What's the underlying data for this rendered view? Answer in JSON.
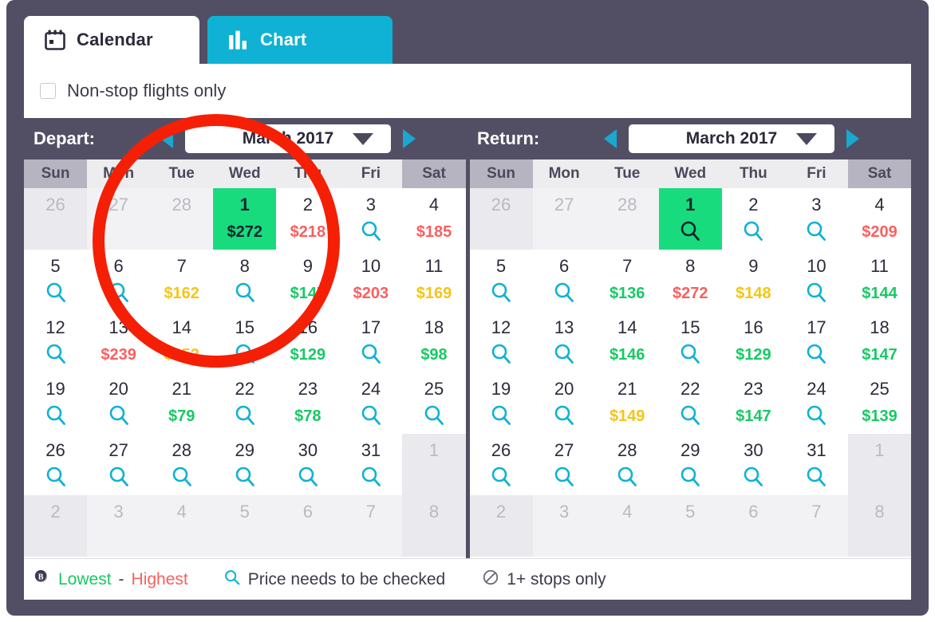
{
  "tabs": [
    {
      "id": "calendar",
      "label": "Calendar",
      "icon": "calendar-icon",
      "active": true
    },
    {
      "id": "chart",
      "label": "Chart",
      "icon": "bar-chart-icon",
      "active": false
    }
  ],
  "filters": {
    "nonstop_label": "Non-stop flights only",
    "nonstop_checked": false
  },
  "colors": {
    "panel": "#524f65",
    "accent_teal": "#0fb2d4",
    "selected_green": "#18db7e",
    "price_low": "#17c964",
    "price_mid": "#f5c518",
    "price_high": "#fb5f5f",
    "annotation_red": "#f51f05"
  },
  "depart": {
    "label": "Depart:",
    "month": "March 2017",
    "prev_icon": "triangle-left-icon",
    "next_icon": "triangle-right-icon",
    "caret_icon": "chevron-down-icon",
    "dow": [
      "Sun",
      "Mon",
      "Tue",
      "Wed",
      "Thu",
      "Fri",
      "Sat"
    ],
    "weeks": [
      [
        {
          "day": "26",
          "out": true
        },
        {
          "day": "27",
          "out": true
        },
        {
          "day": "28",
          "out": true
        },
        {
          "day": "1",
          "price": "$272",
          "tier": "sel",
          "selected": true
        },
        {
          "day": "2",
          "price": "$218",
          "tier": "high"
        },
        {
          "day": "3",
          "mag": true
        },
        {
          "day": "4",
          "price": "$185",
          "tier": "high"
        }
      ],
      [
        {
          "day": "5",
          "mag": true
        },
        {
          "day": "6",
          "mag": true
        },
        {
          "day": "7",
          "price": "$162",
          "tier": "mid"
        },
        {
          "day": "8",
          "mag": true
        },
        {
          "day": "9",
          "price": "$147",
          "tier": "low"
        },
        {
          "day": "10",
          "price": "$203",
          "tier": "high"
        },
        {
          "day": "11",
          "price": "$169",
          "tier": "mid"
        }
      ],
      [
        {
          "day": "12",
          "mag": true
        },
        {
          "day": "13",
          "price": "$239",
          "tier": "high"
        },
        {
          "day": "14",
          "price": "$152",
          "tier": "mid"
        },
        {
          "day": "15",
          "mag": true
        },
        {
          "day": "16",
          "price": "$129",
          "tier": "low"
        },
        {
          "day": "17",
          "mag": true
        },
        {
          "day": "18",
          "price": "$98",
          "tier": "low"
        }
      ],
      [
        {
          "day": "19",
          "mag": true
        },
        {
          "day": "20",
          "mag": true
        },
        {
          "day": "21",
          "price": "$79",
          "tier": "low"
        },
        {
          "day": "22",
          "mag": true
        },
        {
          "day": "23",
          "price": "$78",
          "tier": "low"
        },
        {
          "day": "24",
          "mag": true
        },
        {
          "day": "25",
          "mag": true
        }
      ],
      [
        {
          "day": "26",
          "mag": true
        },
        {
          "day": "27",
          "mag": true
        },
        {
          "day": "28",
          "mag": true
        },
        {
          "day": "29",
          "mag": true
        },
        {
          "day": "30",
          "mag": true
        },
        {
          "day": "31",
          "mag": true
        },
        {
          "day": "1",
          "out": true
        }
      ],
      [
        {
          "day": "2",
          "out": true
        },
        {
          "day": "3",
          "out": true
        },
        {
          "day": "4",
          "out": true
        },
        {
          "day": "5",
          "out": true
        },
        {
          "day": "6",
          "out": true
        },
        {
          "day": "7",
          "out": true
        },
        {
          "day": "8",
          "out": true
        }
      ]
    ]
  },
  "return": {
    "label": "Return:",
    "month": "March 2017",
    "prev_icon": "triangle-left-icon",
    "next_icon": "triangle-right-icon",
    "caret_icon": "chevron-down-icon",
    "dow": [
      "Sun",
      "Mon",
      "Tue",
      "Wed",
      "Thu",
      "Fri",
      "Sat"
    ],
    "weeks": [
      [
        {
          "day": "26",
          "out": true
        },
        {
          "day": "27",
          "out": true
        },
        {
          "day": "28",
          "out": true
        },
        {
          "day": "1",
          "mag": true,
          "selected": true
        },
        {
          "day": "2",
          "mag": true
        },
        {
          "day": "3",
          "mag": true
        },
        {
          "day": "4",
          "price": "$209",
          "tier": "high"
        }
      ],
      [
        {
          "day": "5",
          "mag": true
        },
        {
          "day": "6",
          "mag": true
        },
        {
          "day": "7",
          "price": "$136",
          "tier": "low"
        },
        {
          "day": "8",
          "price": "$272",
          "tier": "high"
        },
        {
          "day": "9",
          "price": "$148",
          "tier": "mid"
        },
        {
          "day": "10",
          "mag": true
        },
        {
          "day": "11",
          "price": "$144",
          "tier": "low"
        }
      ],
      [
        {
          "day": "12",
          "mag": true
        },
        {
          "day": "13",
          "mag": true
        },
        {
          "day": "14",
          "price": "$146",
          "tier": "low"
        },
        {
          "day": "15",
          "mag": true
        },
        {
          "day": "16",
          "price": "$129",
          "tier": "low"
        },
        {
          "day": "17",
          "mag": true
        },
        {
          "day": "18",
          "price": "$147",
          "tier": "low"
        }
      ],
      [
        {
          "day": "19",
          "mag": true
        },
        {
          "day": "20",
          "mag": true
        },
        {
          "day": "21",
          "price": "$149",
          "tier": "mid"
        },
        {
          "day": "22",
          "mag": true
        },
        {
          "day": "23",
          "price": "$147",
          "tier": "low"
        },
        {
          "day": "24",
          "mag": true
        },
        {
          "day": "25",
          "price": "$139",
          "tier": "low"
        }
      ],
      [
        {
          "day": "26",
          "mag": true
        },
        {
          "day": "27",
          "mag": true
        },
        {
          "day": "28",
          "mag": true
        },
        {
          "day": "29",
          "mag": true
        },
        {
          "day": "30",
          "mag": true
        },
        {
          "day": "31",
          "mag": true
        },
        {
          "day": "1",
          "out": true
        }
      ],
      [
        {
          "day": "2",
          "out": true
        },
        {
          "day": "3",
          "out": true
        },
        {
          "day": "4",
          "out": true
        },
        {
          "day": "5",
          "out": true
        },
        {
          "day": "6",
          "out": true
        },
        {
          "day": "7",
          "out": true
        },
        {
          "day": "8",
          "out": true
        }
      ]
    ]
  },
  "legend": {
    "price_icon": "price-tag-icon",
    "lowest": "Lowest",
    "dash": "-",
    "highest": "Highest",
    "search_icon": "magnifier-icon",
    "price_check": "Price needs to be checked",
    "stops_icon": "no-entry-icon",
    "stops": "1+ stops only"
  },
  "annotation": {
    "shape": "red-ellipse-highlight"
  }
}
